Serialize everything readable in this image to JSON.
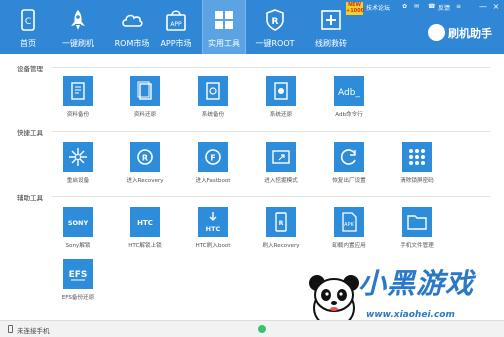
{
  "nav": {
    "items": [
      {
        "label": "首页",
        "icon": "phone-home-icon"
      },
      {
        "label": "一键刷机",
        "icon": "rocket-icon"
      },
      {
        "label": "ROM市场",
        "icon": "cloud-icon"
      },
      {
        "label": "APP市场",
        "icon": "app-bag-icon"
      },
      {
        "label": "实用工具",
        "icon": "grid-icon"
      },
      {
        "label": "一键ROOT",
        "icon": "shield-r-icon"
      },
      {
        "label": "线刷救砖",
        "icon": "plus-box-icon"
      }
    ],
    "active": "实用工具",
    "new_badge": "NEW +1000"
  },
  "top_links": {
    "forum": "技术论坛",
    "feedback": "反馈",
    "minimize": "—",
    "close": "×"
  },
  "brand": {
    "name": "刷机助手"
  },
  "sections": [
    {
      "title": "设备管理",
      "tools": [
        {
          "label": "资料备份",
          "icon": "data-backup-icon"
        },
        {
          "label": "资料还原",
          "icon": "data-restore-icon"
        },
        {
          "label": "系统备份",
          "icon": "system-backup-icon"
        },
        {
          "label": "系统还原",
          "icon": "system-restore-icon"
        },
        {
          "label": "Adb命令行",
          "icon": "adb-terminal-icon",
          "tile_text": "Adb_"
        }
      ]
    },
    {
      "title": "快捷工具",
      "tools": [
        {
          "label": "重启设备",
          "icon": "reboot-icon"
        },
        {
          "label": "进入Recovery",
          "icon": "recovery-icon"
        },
        {
          "label": "进入Fastboot",
          "icon": "fastboot-icon"
        },
        {
          "label": "进入挖掘模式",
          "icon": "mining-mode-icon"
        },
        {
          "label": "恢复出厂设置",
          "icon": "factory-reset-icon"
        },
        {
          "label": "清除锁屏密码",
          "icon": "clear-lock-icon"
        }
      ]
    },
    {
      "title": "辅助工具",
      "tools": [
        {
          "label": "Sony解锁",
          "icon": "sony-unlock-icon",
          "tile_text": "SONY"
        },
        {
          "label": "HTC解锁上锁",
          "icon": "htc-unlock-icon",
          "tile_text": "HTC"
        },
        {
          "label": "HTC刷入boot",
          "icon": "htc-boot-icon",
          "tile_text": "HTC"
        },
        {
          "label": "刷入Recovery",
          "icon": "flash-recovery-icon"
        },
        {
          "label": "卸载内置应用",
          "icon": "uninstall-app-icon",
          "tile_text": "APK"
        },
        {
          "label": "手机文件管理",
          "icon": "file-manager-icon"
        },
        {
          "label": "EFS备份还原",
          "icon": "efs-backup-icon",
          "tile_text": "EFS"
        }
      ]
    }
  ],
  "status": {
    "text": "未连接手机"
  },
  "watermark": {
    "text": "小黑游戏",
    "url": "www.xiaohei.com"
  },
  "colors": {
    "topbar": "#2f87d6",
    "tile": "#2d8ddb",
    "active_tab": "#5ba3e3"
  }
}
